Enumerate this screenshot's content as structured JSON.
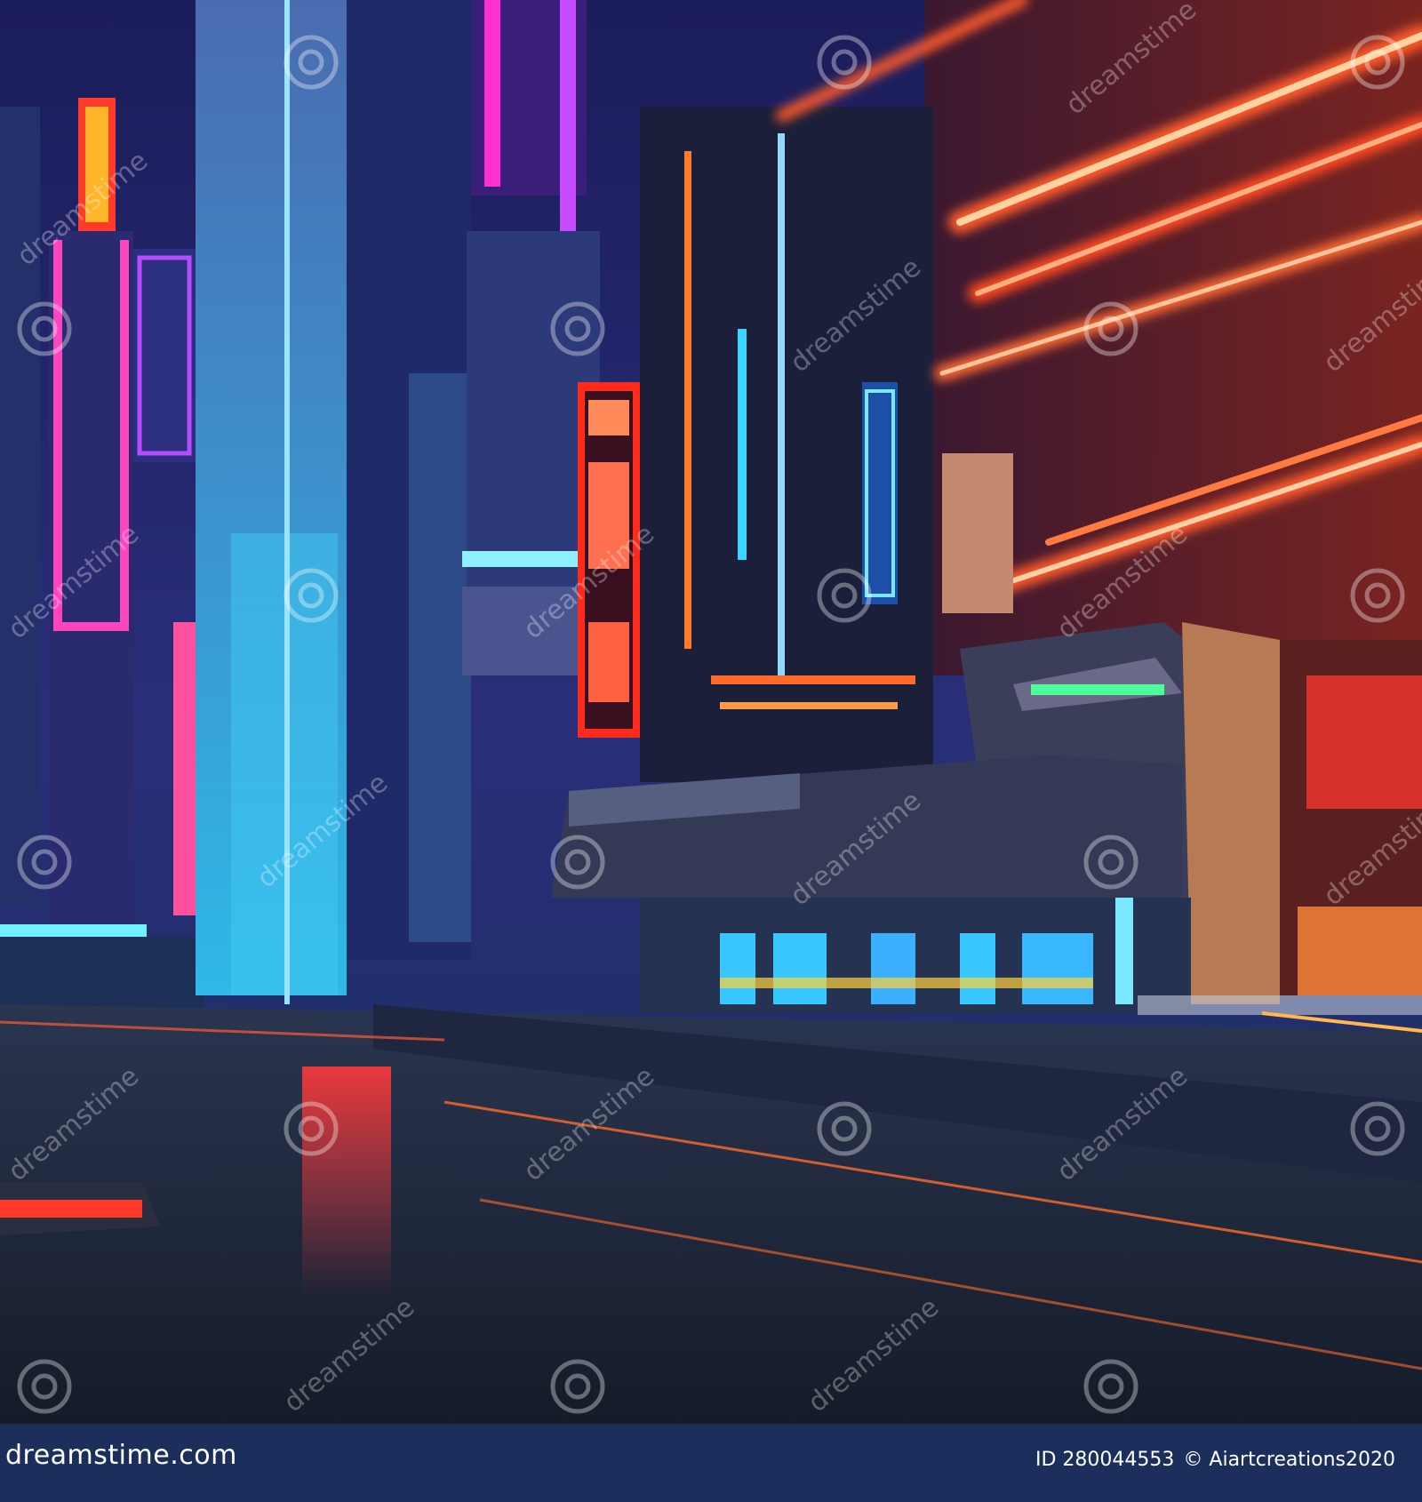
{
  "image": {
    "subject": "cyberpunk-neon-city-street"
  },
  "palette": {
    "sky": "#1a1d5c",
    "neon_pink": "#ff3fb4",
    "neon_cyan": "#35d8ff",
    "neon_orange": "#ff6a2a",
    "neon_red": "#ff2a3a",
    "wet_street": "#1c2436",
    "footer_bg": "#1b2e5c"
  },
  "watermark": {
    "text": "dreamstime"
  },
  "footer": {
    "logo_text": "dreamstime.com",
    "image_id": "ID 280044553",
    "credit_icon": "copyright-icon",
    "credit_symbol": "©",
    "author": "Aiartcreations2020"
  }
}
